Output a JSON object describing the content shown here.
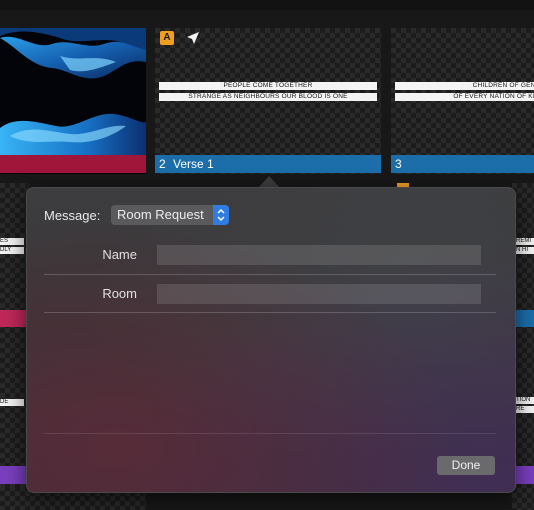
{
  "slides": [
    {
      "id": "slide-1",
      "number": "",
      "title": "",
      "label_color": "#a0163a",
      "lines": []
    },
    {
      "id": "slide-2",
      "number": "2",
      "title": "Verse 1",
      "label_color": "#1c6eab",
      "lines": [
        "PEOPLE COME TOGETHER",
        "STRANGE AS NEIGHBOURS OUR BLOOD IS ONE"
      ]
    },
    {
      "id": "slide-3",
      "number": "3",
      "title": "",
      "label_color": "#1c6eab",
      "lines": [
        "CHILDREN OF GENER",
        "OF EVERY NATION OF KING"
      ]
    }
  ],
  "left_edge_text": [
    "ES",
    "DLY",
    "DE"
  ],
  "right_edge_text": [
    "REMI",
    "N HI",
    "TION",
    "RE"
  ],
  "slide2_badge": "A",
  "message": {
    "label": "Message:",
    "selected": "Room Request",
    "fields": [
      {
        "label": "Name",
        "value": "",
        "placeholder": ""
      },
      {
        "label": "Room",
        "value": "",
        "placeholder": ""
      }
    ],
    "done_label": "Done"
  },
  "colors": {
    "accent_blue": "#1c6eab",
    "crimson": "#a0163a",
    "badge_orange": "#f0a020",
    "purple": "#7a3fbf"
  }
}
